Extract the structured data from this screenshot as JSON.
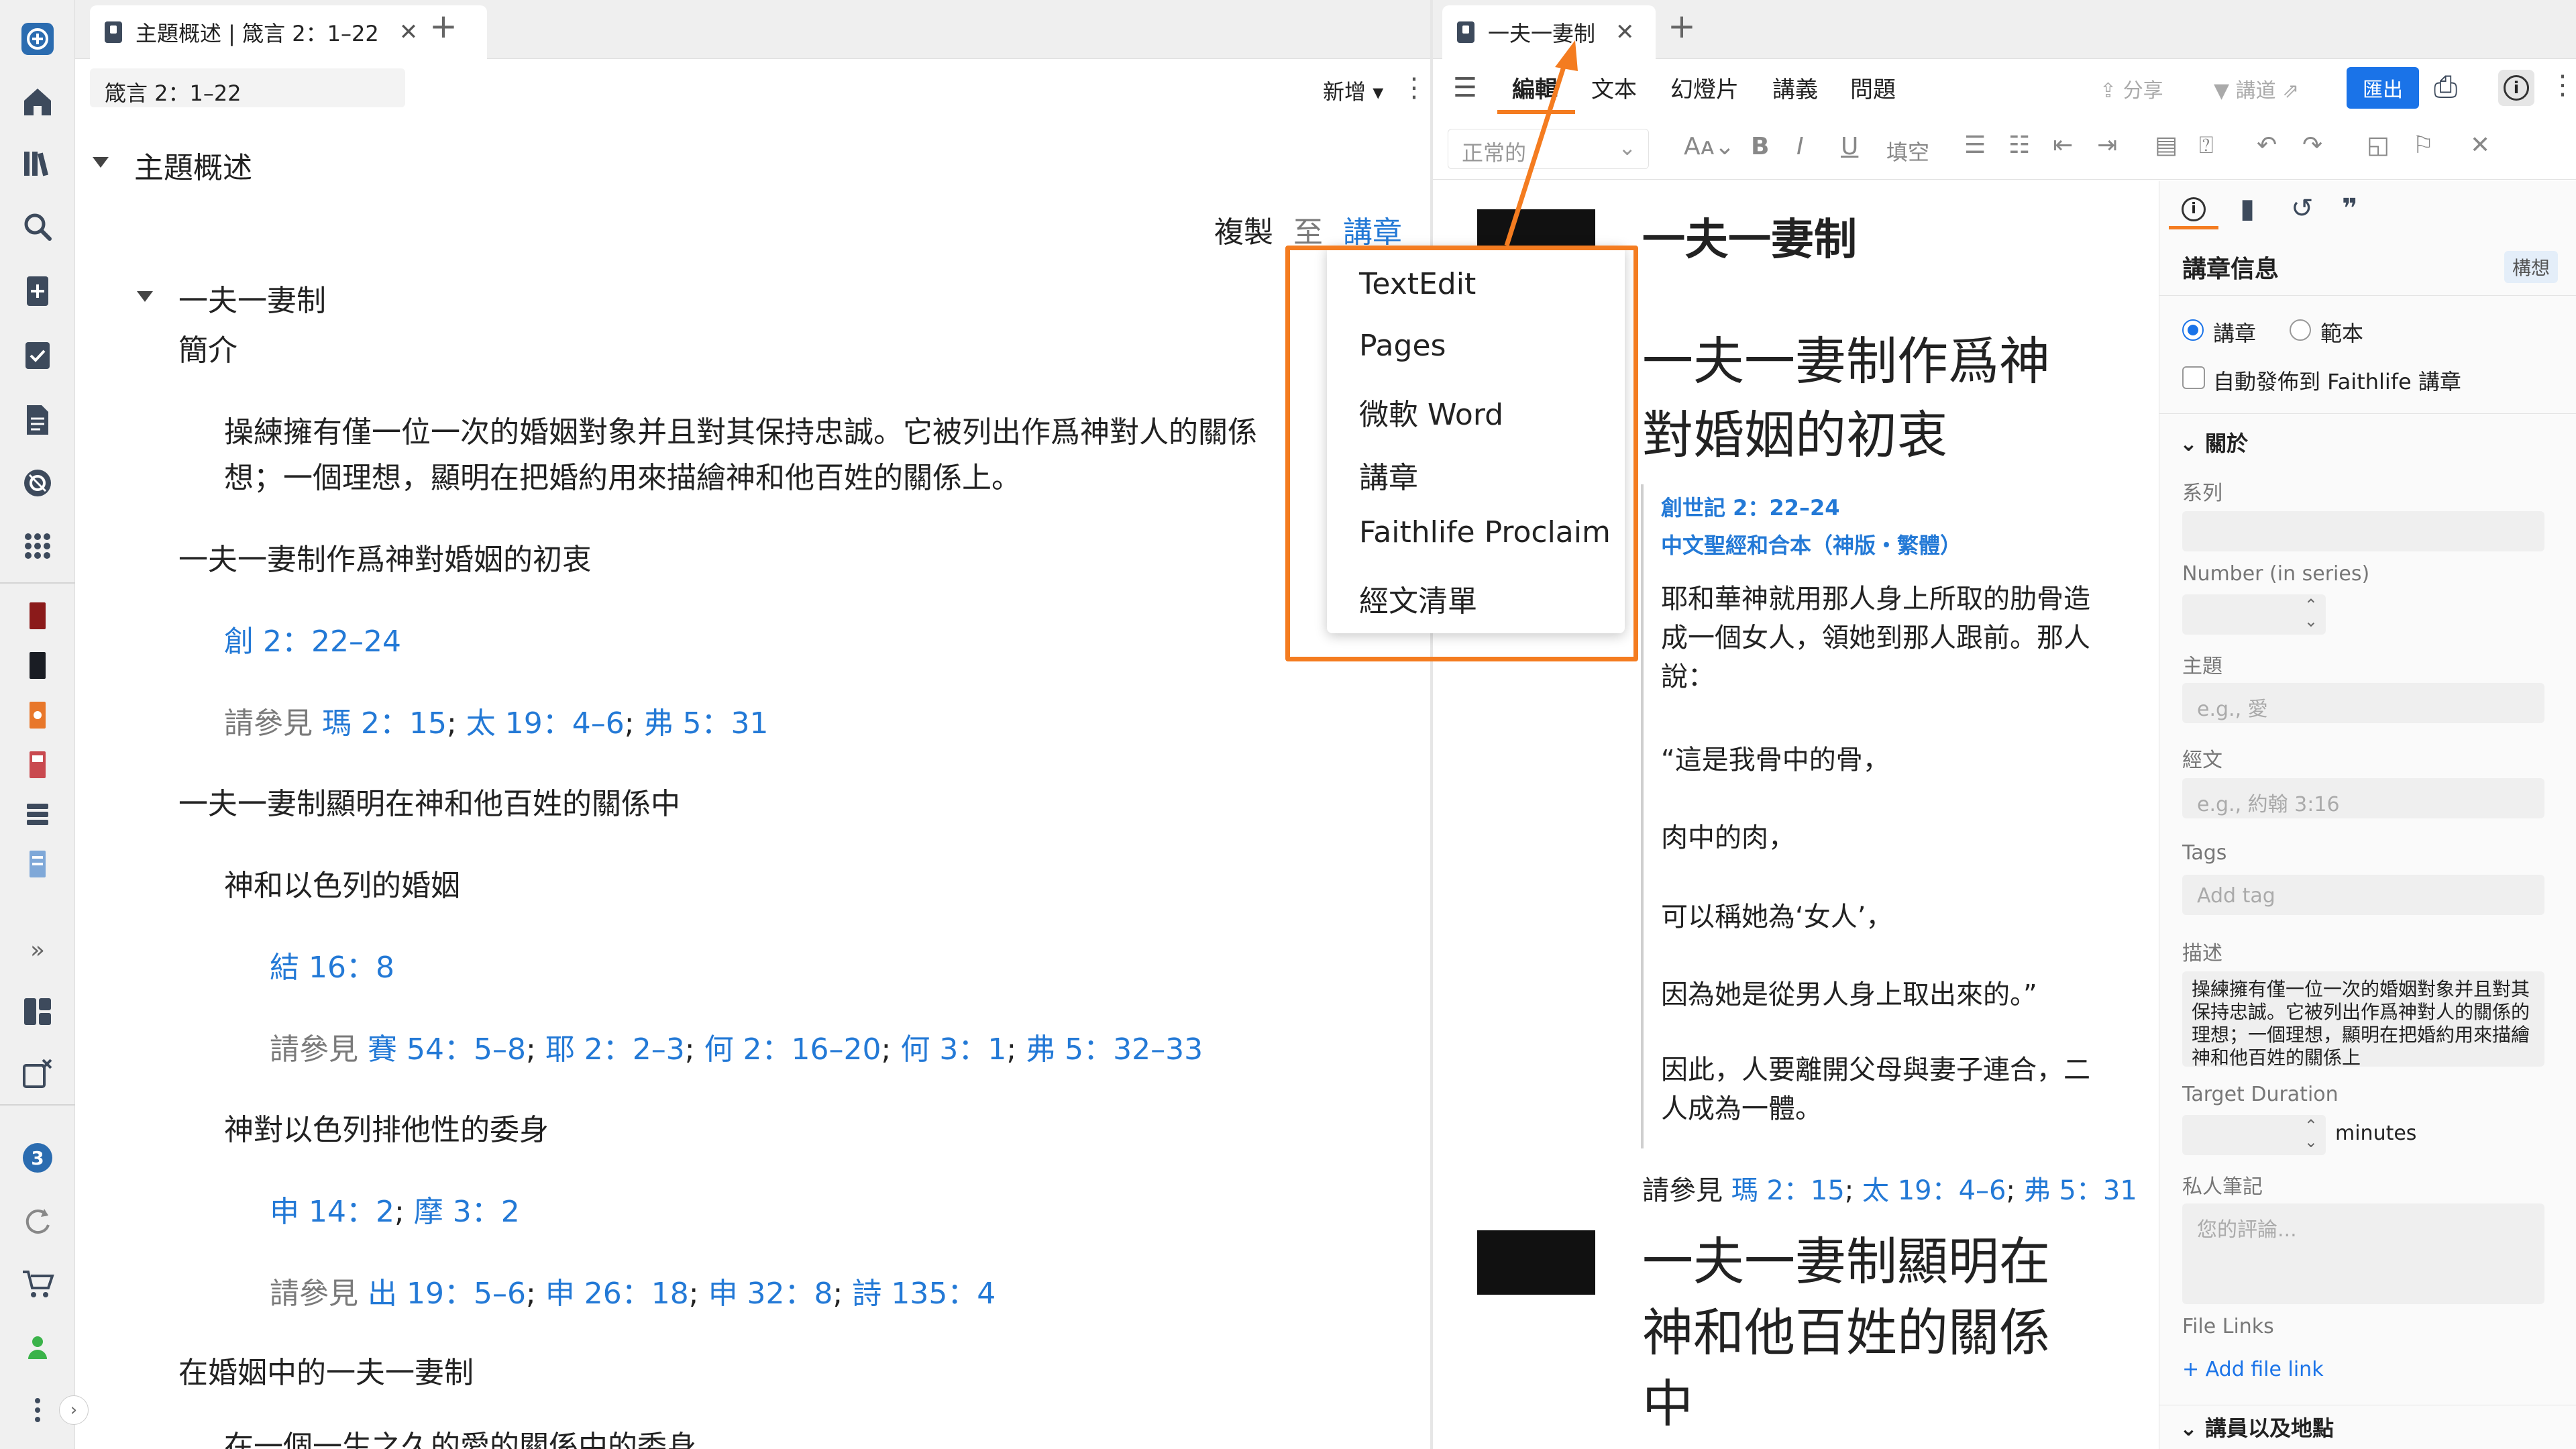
{
  "rail": {
    "badge": "3",
    "icons": [
      "app-logo-icon",
      "home-icon",
      "library-icon",
      "search-icon",
      "add-doc-icon",
      "checklist-icon",
      "document-icon",
      "shield-icon",
      "apps-grid-icon",
      "book-red-icon",
      "book-black-icon",
      "book-orange-icon",
      "book-pink-icon",
      "stack-icon",
      "book-blue-icon",
      "expand-icon",
      "layout-icon",
      "close-panels-icon",
      "notifications-badge",
      "sync-icon",
      "cart-icon",
      "user-icon",
      "more-icon"
    ]
  },
  "left": {
    "tab_title": "主題概述 | 箴言 2：1–22",
    "ref": "箴言 2：1–22",
    "add_label": "新增",
    "section_title": "主題概述",
    "copy_label": "複製",
    "copy_to": "至",
    "copy_target": "講章",
    "outline": {
      "topic": "一夫一妻制",
      "intro": "簡介",
      "intro_text_1": "操練擁有僅一位一次的婚姻對象并且對其保持忠誠。它被列出作爲神對人的關係",
      "intro_text_2": "想；一個理想，顯明在把婚約用來描繪神和他百姓的關係上。",
      "h1": "一夫一妻制作爲神對婚姻的初衷",
      "h1_ref": "創 2：22–24",
      "see_also": "請參見",
      "h1_see": [
        "瑪 2：15",
        "太 19：4–6",
        "弗 5：31"
      ],
      "h2": "一夫一妻制顯明在神和他百姓的關係中",
      "h2a": "神和以色列的婚姻",
      "h2a_ref": "結 16：8",
      "h2a_see": [
        "賽 54：5–8",
        "耶 2：2–3",
        "何 2：16–20",
        "何 3：1",
        "弗 5：32–33"
      ],
      "h2b": "神對以色列排他性的委身",
      "h2b_refs": [
        "申 14：2",
        "摩 3：2"
      ],
      "h2b_see": [
        "出 19：5–6",
        "申 26：18",
        "申 32：8",
        "詩 135：4"
      ],
      "h3": "在婚姻中的一夫一妻制",
      "h3a": "在一個一生之久的愛的關係中的委身"
    }
  },
  "right": {
    "tab_title": "一夫一妻制",
    "menu": [
      "編輯",
      "文本",
      "幻燈片",
      "講義",
      "問題"
    ],
    "share": "分享",
    "preach": "講道",
    "export": "匯出",
    "style_select": "正常的",
    "fill_label": "填空",
    "doc": {
      "title": "一夫一妻制",
      "h1": "一夫一妻制作爲神對婚姻的初衷",
      "ref": "創世記 2：22–24",
      "version": "中文聖經和合本（神版・繁體）",
      "p1": "耶和華神就用那人身上所取的肋骨造成一個女人，領她到那人跟前。那人說：",
      "p2": "“這是我骨中的骨，",
      "p3": "肉中的肉，",
      "p4": "可以稱她為‘女人’，",
      "p5": "因為她是從男人身上取出來的。”",
      "p6": "因此，人要離開父母與妻子連合，二人成為一體。",
      "see_also": "請參見",
      "see": [
        "瑪 2：15",
        "太 19：4–6",
        "弗 5：31"
      ],
      "h2": "一夫一妻制顯明在神和他百姓的關係中"
    },
    "info": {
      "title": "講章信息",
      "badge": "構想",
      "radio_sermon": "講章",
      "radio_template": "範本",
      "auto_publish": "自動發佈到 Faithlife 講章",
      "about": "關於",
      "series": "系列",
      "number": "Number (in series)",
      "topic": "主題",
      "topic_ph": "e.g., 愛",
      "scripture": "經文",
      "scripture_ph": "e.g., 約翰 3:16",
      "tags": "Tags",
      "tags_ph": "Add tag",
      "desc": "描述",
      "desc_text": "操練擁有僅一位一次的婚姻對象并且對其保持忠誠。它被列出作爲神對人的關係的理想；一個理想，顯明在把婚約用來描繪神和他百姓的關係上",
      "duration": "Target Duration",
      "minutes": "minutes",
      "notes": "私人筆記",
      "notes_ph": "您的評論...",
      "file_links": "File Links",
      "add_file": "+ Add file link",
      "speakers": "講員以及地點"
    }
  },
  "popup": {
    "items": [
      "TextEdit",
      "Pages",
      "微軟 Word",
      "講章",
      "Faithlife Proclaim",
      "經文清單"
    ]
  },
  "colors": {
    "link": "#2379d6",
    "accent": "#f47c20",
    "export": "#1a73e8",
    "rail": "#f0f0f0"
  }
}
